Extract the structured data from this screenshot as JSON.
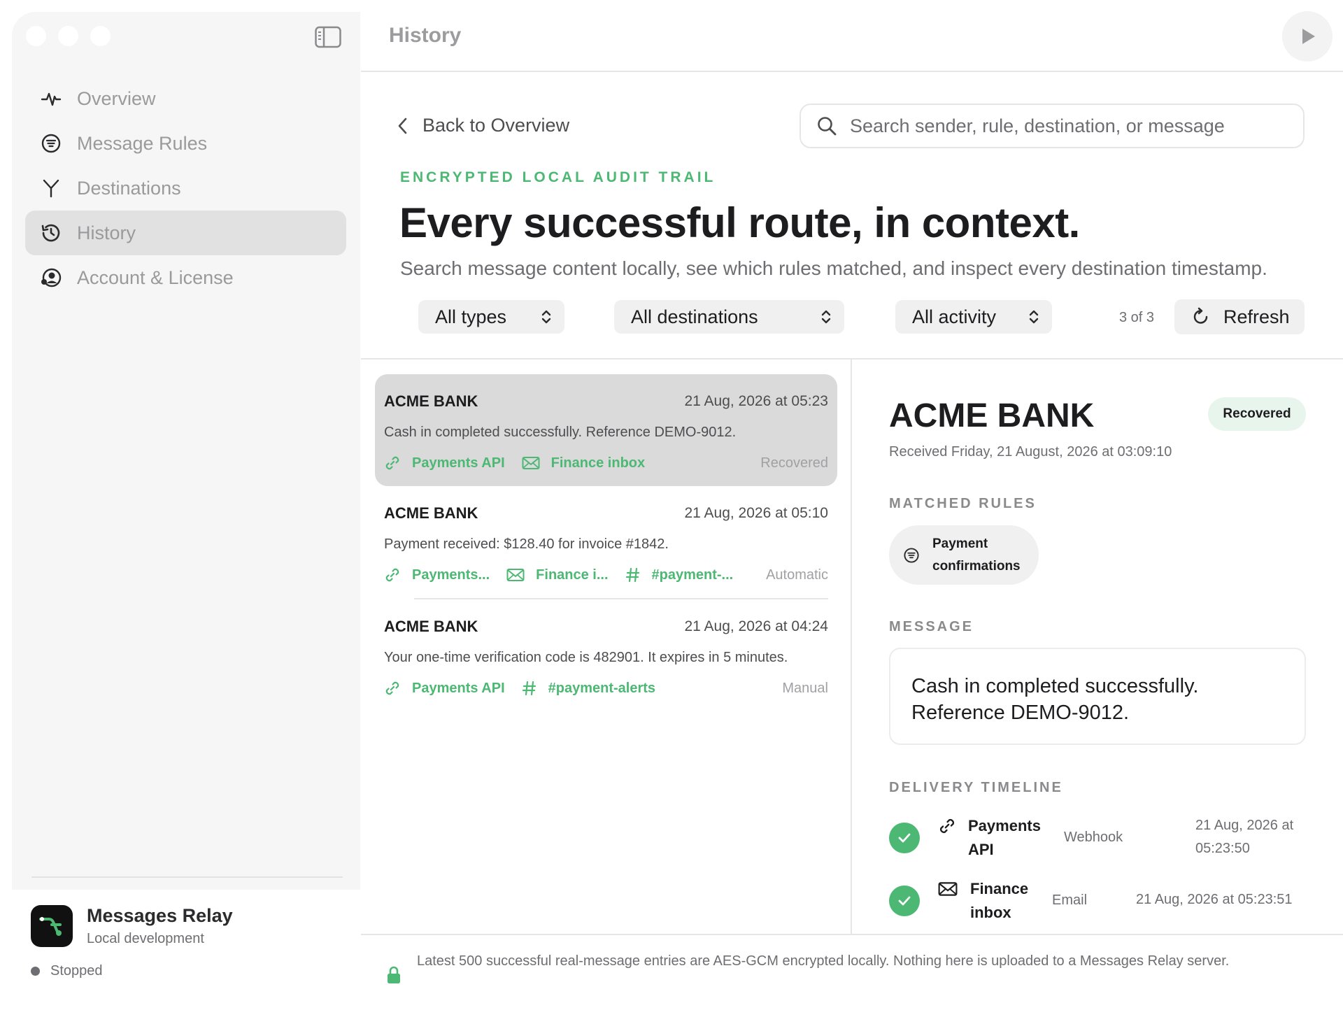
{
  "window": {
    "title": "History"
  },
  "sidebar": {
    "items": [
      {
        "label": "Overview",
        "icon": "activity-icon",
        "active": false
      },
      {
        "label": "Message Rules",
        "icon": "rules-icon",
        "active": false
      },
      {
        "label": "Destinations",
        "icon": "fork-icon",
        "active": false
      },
      {
        "label": "History",
        "icon": "history-icon",
        "active": true
      },
      {
        "label": "Account & License",
        "icon": "account-icon",
        "active": false
      }
    ],
    "app": {
      "name": "Messages Relay",
      "subtitle": "Local development",
      "status": "Stopped"
    }
  },
  "header": {
    "back_label": "Back to Overview",
    "search_placeholder": "Search sender, rule, destination, or message",
    "eyebrow": "ENCRYPTED LOCAL AUDIT TRAIL",
    "headline": "Every successful route, in context.",
    "subhead": "Search message content locally, see which rules matched, and inspect every destination timestamp."
  },
  "filters": {
    "types": "All types",
    "destinations": "All destinations",
    "activity": "All activity",
    "count": "3 of 3",
    "refresh_label": "Refresh"
  },
  "messages": [
    {
      "sender": "ACME BANK",
      "time": "21 Aug, 2026 at 05:23",
      "body": "Cash in completed successfully. Reference DEMO-9012.",
      "tags": [
        "Payments API",
        "Finance inbox"
      ],
      "state": "Recovered"
    },
    {
      "sender": "ACME BANK",
      "time": "21 Aug, 2026 at 05:10",
      "body": "Payment received: $128.40 for invoice #1842.",
      "tags": [
        "Payments...",
        "Finance i...",
        "#payment-..."
      ],
      "state": "Automatic"
    },
    {
      "sender": "ACME BANK",
      "time": "21 Aug, 2026 at 04:24",
      "body": "Your one-time verification code is 482901. It expires in 5 minutes.",
      "tags": [
        "Payments API",
        "#payment-alerts"
      ],
      "state": "Manual"
    }
  ],
  "detail": {
    "sender": "ACME BANK",
    "badge": "Recovered",
    "received": "Received Friday, 21 August, 2026 at 03:09:10",
    "matched_rules_label": "MATCHED RULES",
    "rule": "Payment confirmations",
    "message_label": "MESSAGE",
    "message": "Cash in completed successfully. Reference DEMO-9012.",
    "timeline_label": "DELIVERY TIMELINE",
    "timeline": [
      {
        "name": "Payments API",
        "kind": "Webhook",
        "time": "21 Aug, 2026 at 05:23:50"
      },
      {
        "name": "Finance inbox",
        "kind": "Email",
        "time": "21 Aug, 2026 at 05:23:51"
      }
    ]
  },
  "footer": {
    "note": "Latest 500 successful real-message entries are AES-GCM encrypted locally. Nothing here is uploaded to a Messages Relay server."
  },
  "colors": {
    "accent": "#4cb873",
    "selected_row": "#dadada",
    "sidebar_bg": "#f6f6f6"
  }
}
